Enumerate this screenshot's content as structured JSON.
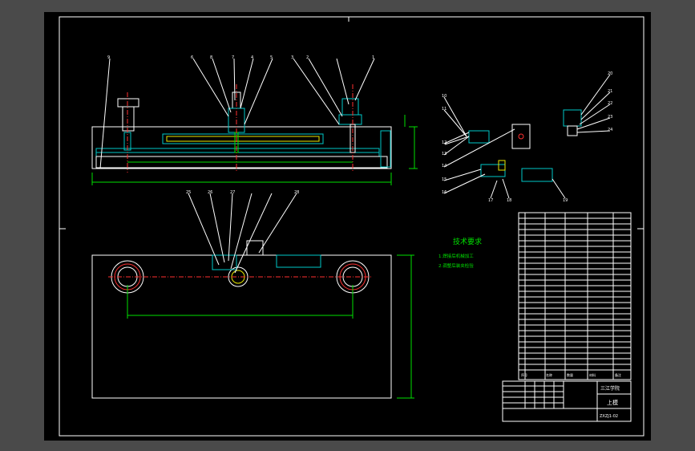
{
  "notes": {
    "title": "技术要求",
    "items": [
      "1.焊接后机械加工",
      "2.调整后装夹检验"
    ]
  },
  "title_block": {
    "school": "三江学院",
    "part_name": "上模",
    "drawing_no": "ZXZJ1-02",
    "bom_header": [
      "序号",
      "名称",
      "数量",
      "材料",
      "备注"
    ]
  },
  "balloons": [
    "6",
    "8",
    "7",
    "4",
    "5",
    "3",
    "2",
    "1",
    "9",
    "10",
    "11",
    "12",
    "13",
    "14",
    "15",
    "16",
    "17",
    "18",
    "19",
    "20",
    "21",
    "22",
    "23",
    "24",
    "25",
    "26",
    "27",
    "28"
  ],
  "colors": {
    "background": "#000000",
    "outline": "#ffffff",
    "hatch": "#00c8c8",
    "dimension": "#00e000",
    "hidden": "#e8e800",
    "center": "#ff3030"
  }
}
